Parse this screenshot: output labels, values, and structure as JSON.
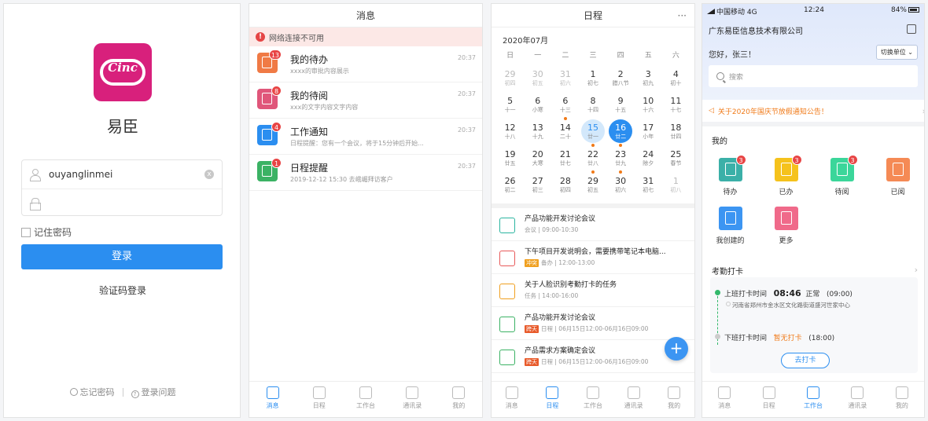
{
  "login": {
    "logo_text": "Cinc",
    "app_name": "易臣",
    "username": "ouyanglinmei",
    "clear_icon": "x",
    "password": "",
    "remember": "记住密码",
    "login_btn": "登录",
    "sms_login": "验证码登录",
    "forgot": "忘记密码",
    "help": "登录问题"
  },
  "messages": {
    "title": "消息",
    "net_error": "网络连接不可用",
    "items": [
      {
        "title": "我的待办",
        "sub": "xxxx的审批内容展示",
        "time": "20:37",
        "badge": "13",
        "color": "#f07a45"
      },
      {
        "title": "我的待阅",
        "sub": "xxx的文字内容文字内容",
        "time": "20:37",
        "badge": "8",
        "color": "#e0567a"
      },
      {
        "title": "工作通知",
        "sub": "日程提醒：您有一个会议，将于15分钟后开始...",
        "time": "20:37",
        "badge": "4",
        "color": "#2b8ef0"
      },
      {
        "title": "日程提醒",
        "sub": "2019-12-12 15:30 去峨嵋拜访客户",
        "time": "20:37",
        "badge": "1",
        "color": "#3bb264"
      }
    ],
    "tabs": [
      "消息",
      "日程",
      "工作台",
      "通讯录",
      "我的"
    ]
  },
  "calendar": {
    "title": "日程",
    "more": "···",
    "month": "2020年07月",
    "weekdays": [
      "日",
      "一",
      "二",
      "三",
      "四",
      "五",
      "六"
    ],
    "days": [
      {
        "n": "29",
        "l": "初四",
        "dim": true
      },
      {
        "n": "30",
        "l": "初五",
        "dim": true
      },
      {
        "n": "31",
        "l": "初六",
        "dim": true
      },
      {
        "n": "1",
        "l": "初七"
      },
      {
        "n": "2",
        "l": "腊八节"
      },
      {
        "n": "3",
        "l": "初九"
      },
      {
        "n": "4",
        "l": "初十"
      },
      {
        "n": "5",
        "l": "十一"
      },
      {
        "n": "6",
        "l": "小寒"
      },
      {
        "n": "6",
        "l": "十三",
        "dot": true
      },
      {
        "n": "8",
        "l": "十四"
      },
      {
        "n": "9",
        "l": "十五"
      },
      {
        "n": "10",
        "l": "十六"
      },
      {
        "n": "11",
        "l": "十七"
      },
      {
        "n": "12",
        "l": "十八"
      },
      {
        "n": "13",
        "l": "十九"
      },
      {
        "n": "14",
        "l": "二十"
      },
      {
        "n": "15",
        "l": "廿一",
        "sel": true,
        "dot": true
      },
      {
        "n": "16",
        "l": "廿二",
        "today": true,
        "dot": true
      },
      {
        "n": "17",
        "l": "小年"
      },
      {
        "n": "18",
        "l": "廿四"
      },
      {
        "n": "19",
        "l": "廿五"
      },
      {
        "n": "20",
        "l": "大寒"
      },
      {
        "n": "21",
        "l": "廿七"
      },
      {
        "n": "22",
        "l": "廿八",
        "dot": true
      },
      {
        "n": "23",
        "l": "廿九",
        "dot": true
      },
      {
        "n": "24",
        "l": "除夕"
      },
      {
        "n": "25",
        "l": "春节"
      },
      {
        "n": "26",
        "l": "初二"
      },
      {
        "n": "27",
        "l": "初三"
      },
      {
        "n": "28",
        "l": "初四"
      },
      {
        "n": "29",
        "l": "初五"
      },
      {
        "n": "30",
        "l": "初六"
      },
      {
        "n": "31",
        "l": "初七"
      },
      {
        "n": "1",
        "l": "初八",
        "dim": true
      }
    ],
    "events": [
      {
        "title": "产品功能开发讨论会议",
        "tag": "",
        "tagcolor": "",
        "sub": "会议 | 09:00-10:30",
        "color": "#2bb5a0"
      },
      {
        "title": "下午项目开发说明会，需要携带笔记本电脑...",
        "tag": "冲突",
        "tagcolor": "#f0a020",
        "sub": "备办 | 12:00-13:00",
        "color": "#e85a5a"
      },
      {
        "title": "关于人脸识别考勤打卡的任务",
        "tag": "",
        "tagcolor": "",
        "sub": "任务 | 14:00-16:00",
        "color": "#f0a020"
      },
      {
        "title": "产品功能开发讨论会议",
        "tag": "跨天",
        "tagcolor": "#e85a2a",
        "sub": "日程 | 06月15日12:00-06月16日09:00",
        "color": "#3bb264"
      },
      {
        "title": "产品需求方案确定会议",
        "tag": "跨天",
        "tagcolor": "#e85a2a",
        "sub": "日程 | 06月15日12:00-06月16日09:00",
        "color": "#3bb264"
      }
    ],
    "fab": "+",
    "tabs": [
      "消息",
      "日程",
      "工作台",
      "通讯录",
      "我的"
    ]
  },
  "workbench": {
    "carrier": "中国移动",
    "network": "4G",
    "clock_time": "12:24",
    "battery": "84%",
    "company": "广东易臣信息技术有限公司",
    "hello": "您好，张三！",
    "switch": "切换单位",
    "search": "搜索",
    "notice": "关于2020年国庆节放假通知公告！",
    "mine_title": "我的",
    "apps": [
      {
        "label": "待办",
        "badge": "3",
        "color": "#3bb0a8"
      },
      {
        "label": "已办",
        "badge": "3",
        "color": "#f5c21c"
      },
      {
        "label": "待阅",
        "badge": "3",
        "color": "#3bd69a"
      },
      {
        "label": "已阅",
        "badge": "",
        "color": "#f58a55"
      },
      {
        "label": "我创建的",
        "badge": "",
        "color": "#3c95f2"
      },
      {
        "label": "更多",
        "badge": "",
        "color": "#f06a8a"
      }
    ],
    "clock_title": "考勤打卡",
    "on_label": "上班打卡时间",
    "on_time": "08:46",
    "on_status": "正常",
    "on_std": "(09:00)",
    "address": "河南省郑州市金水区文化路街道盛河世家中心",
    "off_label": "下班打卡时间",
    "off_status": "暂无打卡",
    "off_std": "(18:00)",
    "clock_btn": "去打卡",
    "tabs": [
      "消息",
      "日程",
      "工作台",
      "通讯录",
      "我的"
    ]
  }
}
